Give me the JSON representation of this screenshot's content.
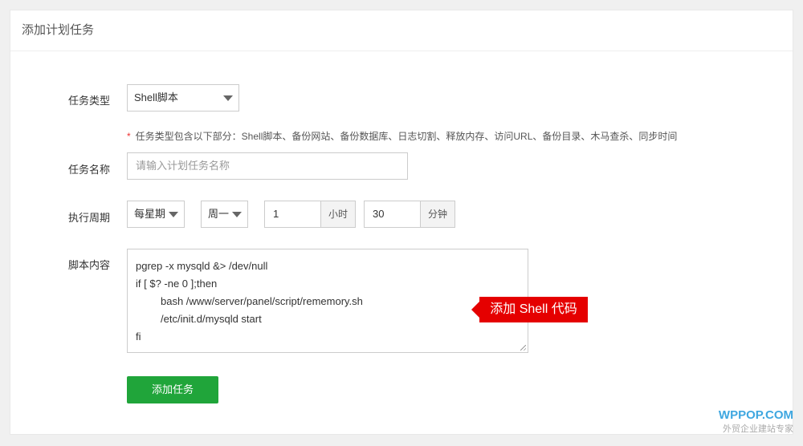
{
  "header": {
    "title": "添加计划任务"
  },
  "form": {
    "task_type": {
      "label": "任务类型",
      "value": "Shell脚本",
      "hint_star": "*",
      "hint": "任务类型包含以下部分：Shell脚本、备份网站、备份数据库、日志切割、释放内存、访问URL、备份目录、木马查杀、同步时间"
    },
    "task_name": {
      "label": "任务名称",
      "placeholder": "请输入计划任务名称"
    },
    "period": {
      "label": "执行周期",
      "cycle_value": "每星期",
      "weekday_value": "周一",
      "hour_value": "1",
      "hour_unit": "小时",
      "minute_value": "30",
      "minute_unit": "分钟"
    },
    "script": {
      "label": "脚本内容",
      "lines": [
        "pgrep -x mysqld &> /dev/null",
        "if [ $? -ne 0 ];then",
        "bash /www/server/panel/script/rememory.sh",
        "/etc/init.d/mysqld start",
        "fi"
      ]
    },
    "callout": "添加 Shell 代码",
    "submit_label": "添加任务"
  },
  "watermark": {
    "brand": "WPPOP.COM",
    "tagline": "外贸企业建站专家"
  },
  "colors": {
    "primary_button": "#20a53a",
    "callout": "#e50000",
    "required_star": "#e33"
  }
}
